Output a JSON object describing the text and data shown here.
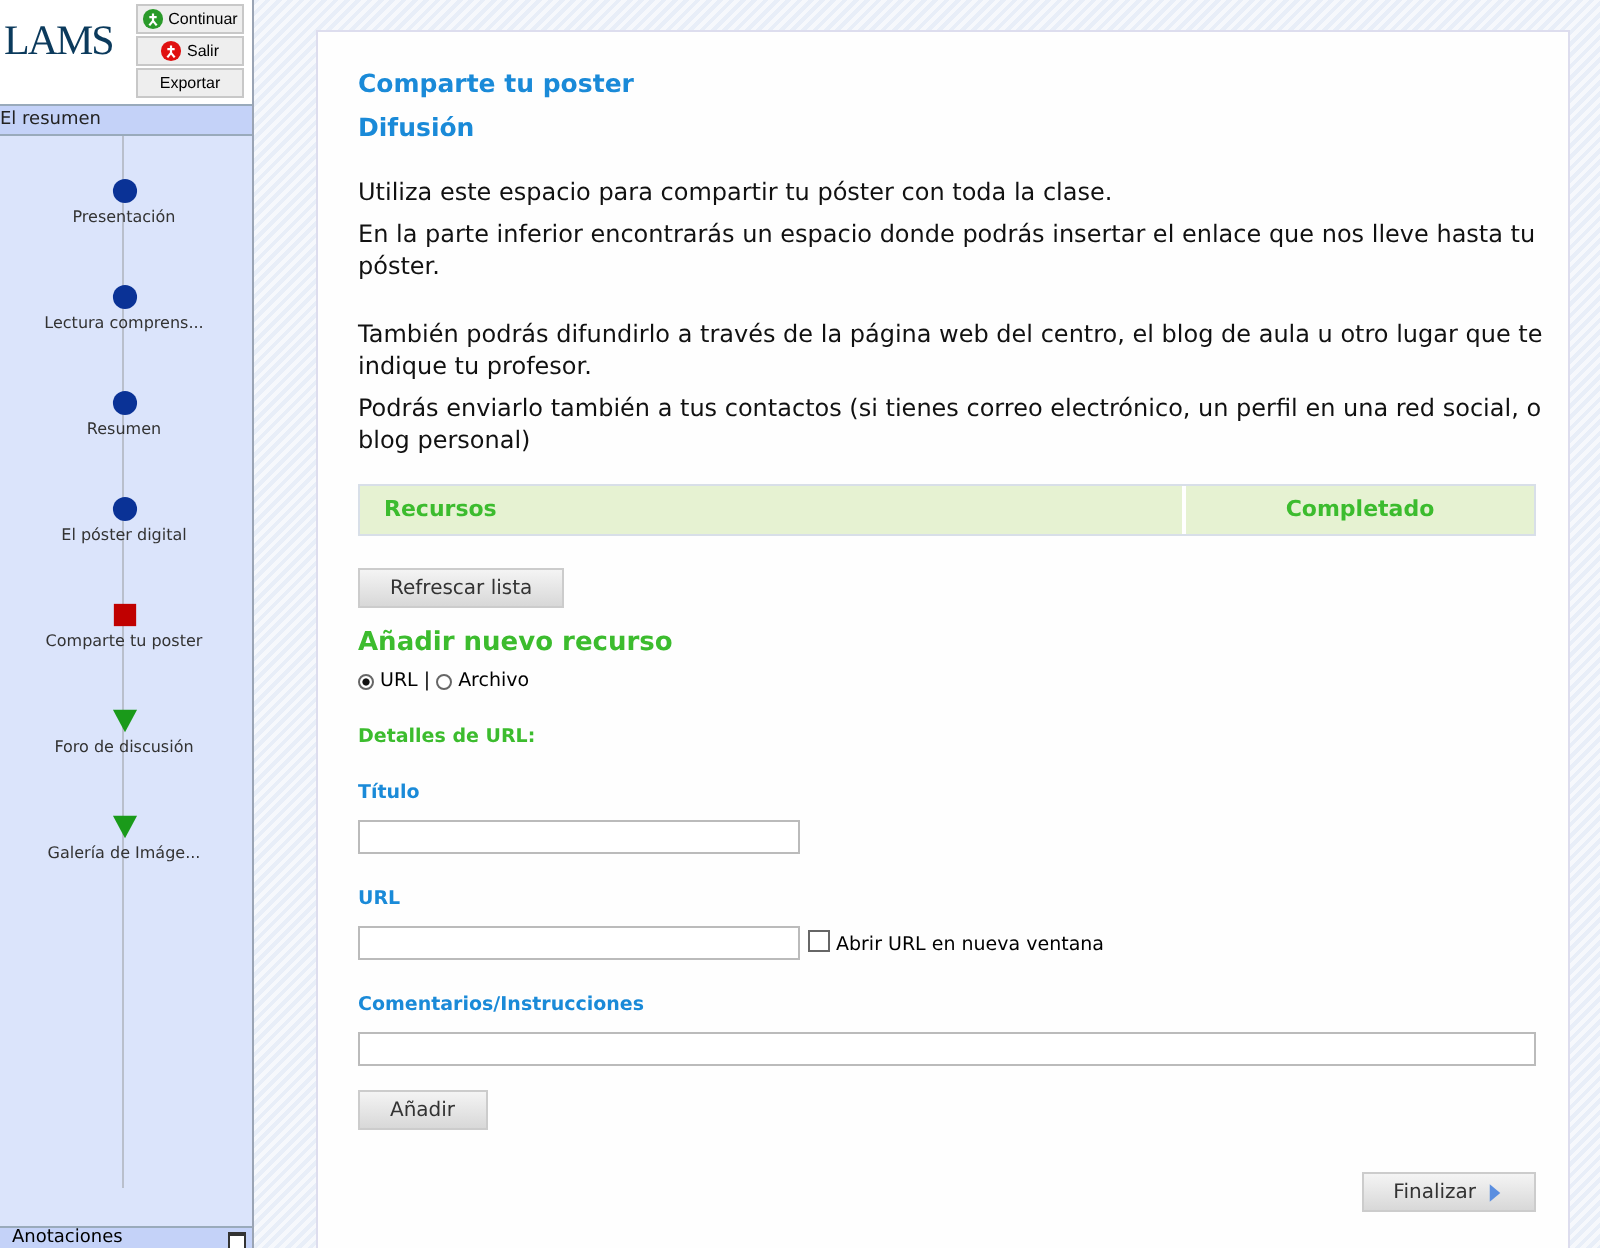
{
  "logo": "LAMS",
  "header_buttons": [
    {
      "label": "Continuar",
      "kind": "go"
    },
    {
      "label": "Salir",
      "kind": "stop"
    },
    {
      "label": "Exportar",
      "kind": "plain"
    }
  ],
  "sequence": {
    "title": "El resumen",
    "activities": [
      {
        "label": "Presentación",
        "kind": "completed"
      },
      {
        "label": "Lectura comprens...",
        "kind": "completed"
      },
      {
        "label": "Resumen",
        "kind": "completed"
      },
      {
        "label": "El póster digital",
        "kind": "completed"
      },
      {
        "label": "Comparte tu poster",
        "kind": "current"
      },
      {
        "label": "Foro de discusión",
        "kind": "todo"
      },
      {
        "label": "Galería de Imáge...",
        "kind": "todo"
      }
    ]
  },
  "notes_bar": {
    "title": "Anotaciones"
  },
  "content": {
    "title": "Comparte tu poster",
    "subtitle": "Difusión",
    "paragraphs": [
      "Utiliza este espacio para compartir tu póster con toda la clase.",
      "En la parte inferior encontrarás un espacio donde podrás insertar el enlace que nos lleve hasta tu póster.",
      "También podrás difundirlo a través de la página web del centro, el blog de aula u otro lugar que te indique tu profesor.",
      "Podrás enviarlo también a tus contactos (si tienes correo electrónico, un perfil en una red social, o blog personal)"
    ],
    "table": {
      "columns": [
        "Recursos",
        "Completado"
      ]
    },
    "refresh_button": "Refrescar lista",
    "add_heading": "Añadir nuevo recurso",
    "type_options": [
      {
        "label": "URL",
        "selected": true
      },
      {
        "label": "Archivo",
        "selected": false
      }
    ],
    "separator": "|",
    "details_heading": "Detalles de URL:",
    "title_label": "Título",
    "url_label": "URL",
    "new_window": {
      "label": "Abrir URL en nueva ventana",
      "checked": false
    },
    "comments_label": "Comentarios/Instrucciones",
    "add_button": "Añadir",
    "finish_button": "Finalizar"
  }
}
